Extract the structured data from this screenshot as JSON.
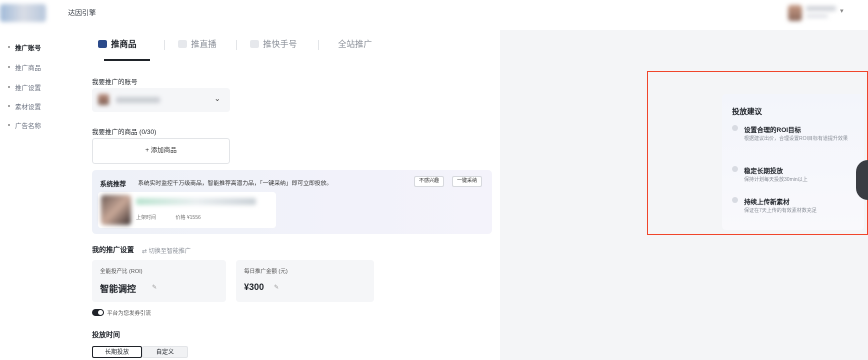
{
  "topbar": {
    "title": "达因引擎",
    "caret": "▾"
  },
  "sidebar": {
    "items": [
      {
        "label": "推广账号",
        "active": true
      },
      {
        "label": "推广商品",
        "active": false
      },
      {
        "label": "推广设置",
        "active": false
      },
      {
        "label": "素材设置",
        "active": false
      },
      {
        "label": "广告名称",
        "active": false
      }
    ]
  },
  "tabs": [
    {
      "label": "推商品",
      "active": true,
      "icon": "cube-icon"
    },
    {
      "label": "推直播",
      "active": false,
      "icon": "live-icon"
    },
    {
      "label": "推快手号",
      "active": false,
      "icon": "account-icon"
    },
    {
      "label": "全站推广",
      "active": false,
      "icon": ""
    }
  ],
  "account": {
    "label": "我要推广的账号",
    "caret": "⌄"
  },
  "products": {
    "label": "我要推广的商品 (0/30)",
    "add_button": "+ 添加商品"
  },
  "recommend": {
    "title": "系统推荐",
    "desc": "系统实时监控千万级商品，智能推荐高潜力品，「一键采纳」即可立即投放。",
    "btn_dislike": "不感兴趣",
    "btn_accept": "一键采纳",
    "product_meta_left": "上架时间",
    "product_meta_right": "价格 ¥1556"
  },
  "settings": {
    "title": "我的推广设置",
    "switch_link": "⇄ 切换至智能推广",
    "card1_small": "全能投产比 (ROI)",
    "card1_big": "智能调控",
    "card2_small": "每日推广金额 (元)",
    "card2_big": "¥300",
    "edit_glyph": "✎",
    "toggle_label": "平台为您发券引流"
  },
  "schedule": {
    "title": "投放时间",
    "options": [
      "长期投放",
      "自定义"
    ]
  },
  "advice": {
    "title": "投放建议",
    "items": [
      {
        "title": "设置合理的ROI目标",
        "desc": "根据建议出价，合理设置ROI目标有道提升效果"
      },
      {
        "title": "稳定长期投放",
        "desc": "保持计划每天投放30min以上"
      },
      {
        "title": "持续上传新素材",
        "desc": "保证在7天上传的有效素材数充足"
      }
    ]
  },
  "colors": {
    "highlight": "#f0452a",
    "primary": "#1f2329"
  }
}
